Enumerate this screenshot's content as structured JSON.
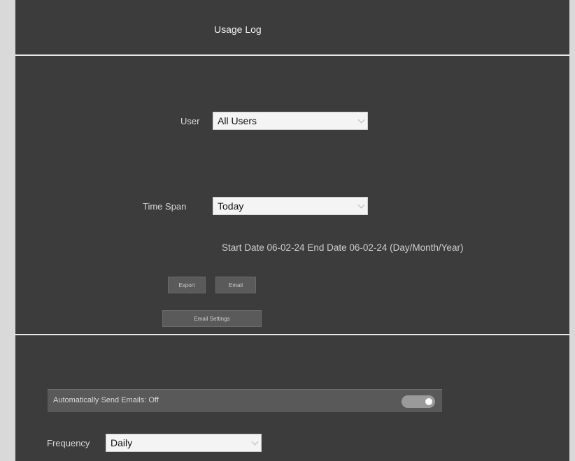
{
  "header": {
    "title": "Usage Log"
  },
  "filters": {
    "user_label": "User",
    "user_value": "All Users",
    "timespan_label": "Time Span",
    "timespan_value": "Today",
    "date_range": "Start Date 06-02-24 End Date 06-02-24 (Day/Month/Year)"
  },
  "actions": {
    "export_label": "Export",
    "email_label": "Email",
    "email_settings_label": "Email Settings"
  },
  "auto_email": {
    "label": "Automatically Send Emails: Off",
    "enabled": false,
    "frequency_label": "Frequency",
    "frequency_value": "Daily"
  },
  "colors": {
    "panel_bg": "#3c3c3c",
    "divider": "#e9e9e9",
    "button_bg": "#5a5a5a",
    "toggle_track": "#9a9a9a"
  }
}
